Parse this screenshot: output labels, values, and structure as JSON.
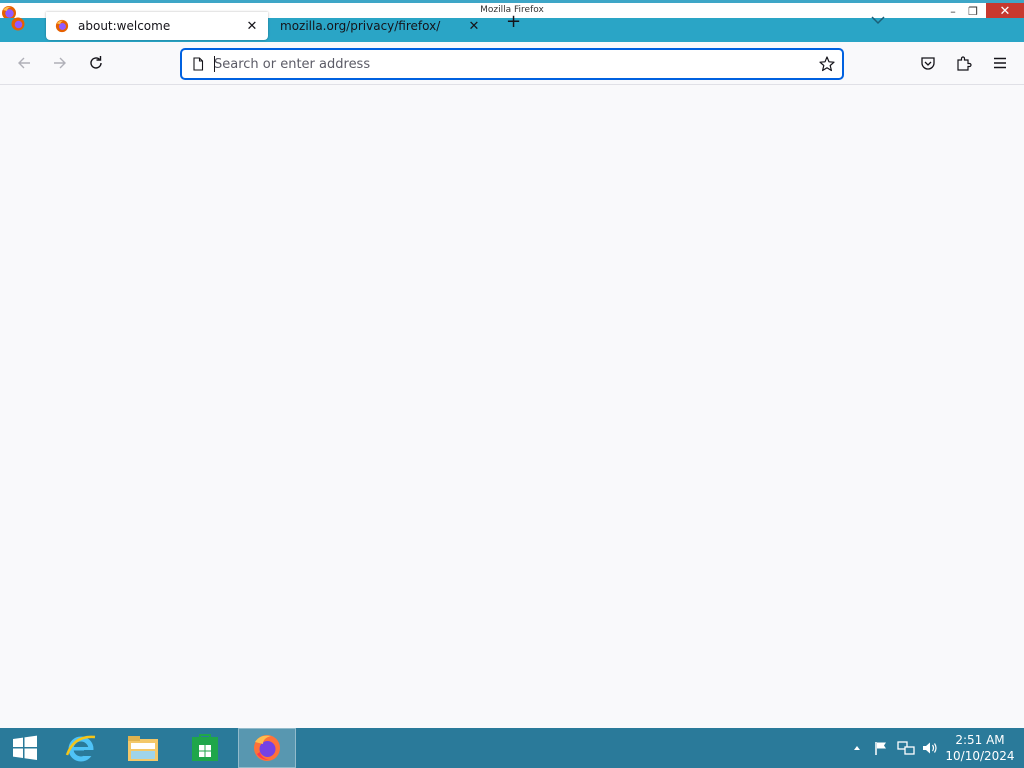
{
  "window": {
    "title": "Mozilla Firefox",
    "controls": {
      "minimize": "–",
      "restore": "❐",
      "close": "✕"
    }
  },
  "tabs": [
    {
      "label": "about:welcome",
      "active": true,
      "close": "✕"
    },
    {
      "label": "mozilla.org/privacy/firefox/",
      "active": false,
      "close": "✕"
    }
  ],
  "tabstrip": {
    "new_tab": "+",
    "list_all_tabs_icon": "chevron-down-icon"
  },
  "navbar": {
    "back_icon": "arrow-left-icon",
    "forward_icon": "arrow-right-icon",
    "reload_icon": "reload-icon",
    "url_placeholder": "Search or enter address",
    "url_value": "",
    "bookmark_icon": "star-icon",
    "pocket_icon": "pocket-icon",
    "extensions_icon": "puzzle-icon",
    "menu_icon": "hamburger-icon"
  },
  "taskbar": {
    "items": [
      "start-icon",
      "internet-explorer-icon",
      "file-explorer-icon",
      "store-icon",
      "firefox-icon"
    ],
    "clock": {
      "time": "2:51 AM",
      "date": "10/10/2024"
    }
  },
  "colors": {
    "tabstrip_bg": "#2aa5c6",
    "taskbar_bg": "#2a7a9a",
    "close_button": "#c7392f",
    "url_focus": "#0061e0",
    "content_bg": "#f9f9fb"
  }
}
